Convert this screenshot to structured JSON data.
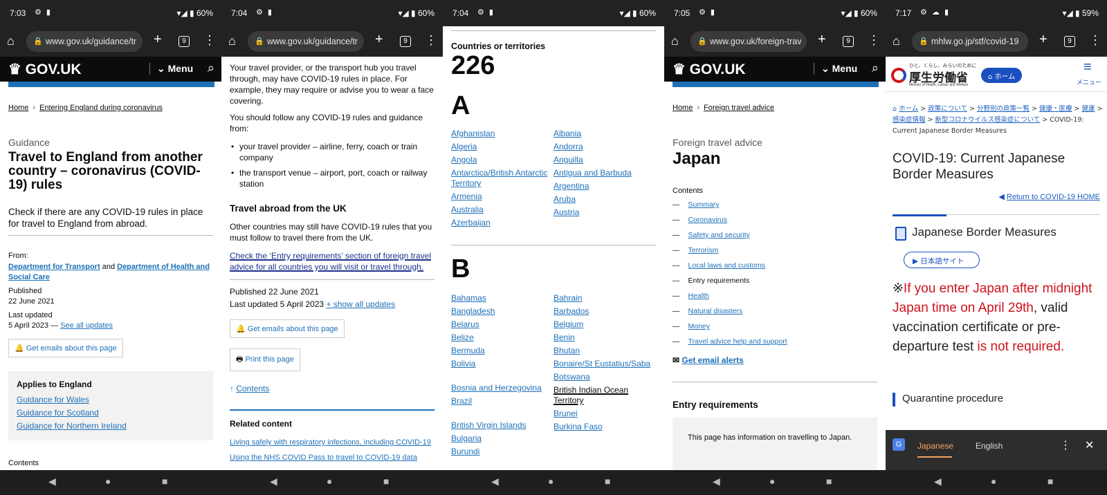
{
  "phones": [
    {
      "time": "7:03",
      "battery": "60%",
      "url": "www.gov.uk/guidance/tr"
    },
    {
      "time": "7:04",
      "battery": "60%",
      "url": "www.gov.uk/guidance/tr"
    },
    {
      "time": "7:04",
      "battery": "60%"
    },
    {
      "time": "7:05",
      "battery": "60%",
      "url": "www.gov.uk/foreign-trav"
    },
    {
      "time": "7:17",
      "battery": "59%",
      "url": "mhlw.go.jp/stf/covid-19"
    }
  ],
  "browser": {
    "tab_count": "9"
  },
  "govuk": {
    "logo": "GOV.UK",
    "menu": "Menu"
  },
  "p1": {
    "crumb_home": "Home",
    "crumb_current": "Entering England during coronavirus",
    "caption": "Guidance",
    "title": "Travel to England from another country – coronavirus (COVID-19) rules",
    "lead": "Check if there are any COVID-19 rules in place for travel to England from abroad.",
    "from_label": "From:",
    "from_org1": "Department for Transport",
    "from_and": "and",
    "from_org2": "Department of Health and Social Care",
    "published_label": "Published",
    "published_date": "22 June 2021",
    "updated_label": "Last updated",
    "updated_date": "5 April 2023 —",
    "see_updates": "See all updates",
    "emails_btn": "Get emails about this page",
    "applies_title": "Applies to England",
    "applies_links": [
      "Guidance for Wales",
      "Guidance for Scotland",
      "Guidance for Northern Ireland"
    ],
    "contents": "Contents"
  },
  "p2": {
    "para1": "Your travel provider, or the transport hub you travel through, may have COVID-19 rules in place. For example, they may require or advise you to wear a face covering.",
    "para2": "You should follow any COVID-19 rules and guidance from:",
    "bullets": [
      "your travel provider – airline, ferry, coach or train company",
      "the transport venue – airport, port, coach or railway station"
    ],
    "h2": "Travel abroad from the UK",
    "para3": "Other countries may still have COVID-19 rules that you must follow to travel there from the UK.",
    "focus_link": "Check the ‘Entry requirements’ section of foreign travel advice for all countries you will visit or travel through.",
    "published": "Published 22 June 2021",
    "last_updated": "Last updated 5 April 2023",
    "show_updates": "+ show all updates",
    "emails_btn": "Get emails about this page",
    "print_btn": "Print this page",
    "contents_link": "Contents",
    "related_title": "Related content",
    "related_links": [
      "Living safely with respiratory infections, including COVID-19",
      "Using the NHS COVID Pass to travel to COVID-19 data"
    ]
  },
  "p3": {
    "count_label": "Countries or territories",
    "count": "226",
    "letter_a": "A",
    "letter_b": "B",
    "a_left": [
      "Afghanistan",
      "Algeria",
      "Angola",
      "Antarctica/British Antarctic Territory",
      "Armenia",
      "Australia",
      "Azerbaijan"
    ],
    "a_right": [
      "Albania",
      "Andorra",
      "Anguilla",
      "Antigua and Barbuda",
      "Argentina",
      "Aruba",
      "Austria"
    ],
    "b_left": [
      "Bahamas",
      "Bangladesh",
      "Belarus",
      "Belize",
      "Bermuda",
      "Bolivia",
      "Bosnia and Herzegovina",
      "Brazil",
      "British Virgin Islands",
      "Bulgaria",
      "Burundi"
    ],
    "b_right": [
      "Bahrain",
      "Barbados",
      "Belgium",
      "Benin",
      "Bhutan",
      "Bonaire/St Eustatius/Saba",
      "Botswana",
      "British Indian Ocean Territory",
      "Brunei",
      "Burkina Faso"
    ]
  },
  "p4": {
    "crumb_home": "Home",
    "crumb_current": "Foreign travel advice",
    "caption": "Foreign travel advice",
    "title": "Japan",
    "contents_label": "Contents",
    "contents": [
      "Summary",
      "Coronavirus",
      "Safety and security",
      "Terrorism",
      "Local laws and customs",
      "Entry requirements",
      "Health",
      "Natural disasters",
      "Money",
      "Travel advice help and support"
    ],
    "current_index": 5,
    "email_alerts": "Get email alerts",
    "h2": "Entry requirements",
    "inset": "This page has information on travelling to Japan."
  },
  "p5": {
    "logo_tagline": "ひと、くらし、みらいのために",
    "logo_name": "厚生労働省",
    "logo_en": "Ministry of Health, Labour and Welfare",
    "home_btn": "ホーム",
    "menu_label": "メニュー",
    "crumbs": [
      "ホーム",
      "政策について",
      "分野別の政策一覧",
      "健康・医療",
      "健康",
      "感染症情報",
      "新型コロナウイルス感染症について"
    ],
    "crumb_current": "COVID-19: Current Japanese Border Measures",
    "title": "COVID-19: Current Japanese Border Measures",
    "return_link": "Return to COVID-19 HOME",
    "section": "Japanese Border Measures",
    "jp_site_btn": "日本語サイト",
    "notice_mark": "※",
    "notice_red1": "If you enter Japan after midnight Japan time on April 29th",
    "notice_black": ", valid vaccination certificate or pre-departure test ",
    "notice_red2": "is not required.",
    "quarantine": "Quarantine procedure",
    "translate_lang1": "Japanese",
    "translate_lang2": "English"
  },
  "colors": {
    "govuk_blue": "#1d70b8",
    "govuk_black": "#0b0c0c",
    "notice_red": "#d0121b",
    "jp_blue": "#1a4fbf",
    "translate_orange": "#f4a361"
  }
}
